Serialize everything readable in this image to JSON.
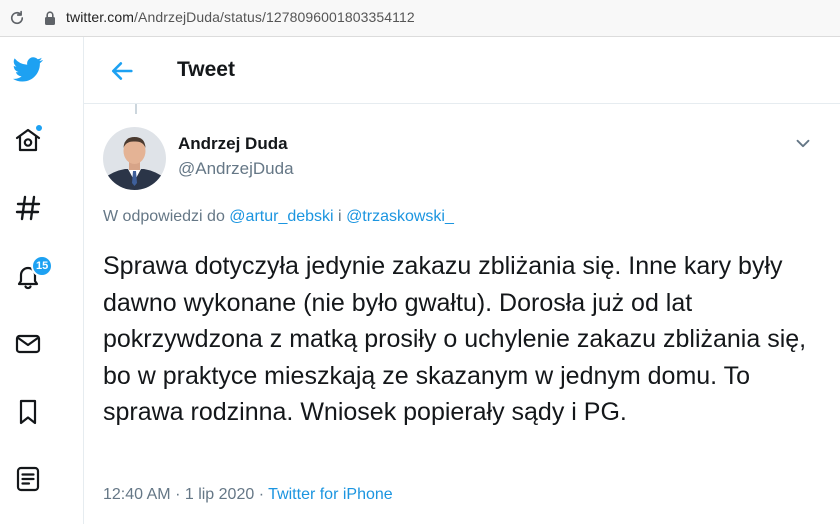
{
  "browser": {
    "url_host": "twitter.com",
    "url_path": "/AndrzejDuda/status/1278096001803354112"
  },
  "sidebar": {
    "items": [
      {
        "name": "twitter-logo"
      },
      {
        "name": "home-icon"
      },
      {
        "name": "explore-icon"
      },
      {
        "name": "notifications-icon",
        "badge": "15"
      },
      {
        "name": "messages-icon"
      },
      {
        "name": "bookmarks-icon"
      },
      {
        "name": "lists-icon"
      }
    ]
  },
  "header": {
    "title": "Tweet"
  },
  "tweet": {
    "author_name": "Andrzej Duda",
    "author_handle": "@AndrzejDuda",
    "reply_prefix": "W odpowiedzi do",
    "reply_mention_1": "@artur_debski",
    "reply_joiner": "i",
    "reply_mention_2": "@trzaskowski_",
    "text": "Sprawa dotyczyła jedynie zakazu zbliżania się. Inne kary były dawno wykonane (nie było gwałtu). Dorosła już od lat pokrzywdzona z matką prosiły o uchylenie zakazu zbliżania się, bo w praktyce mieszkają ze skazanym w jednym domu. To sprawa rodzinna. Wniosek popierały sądy i PG.",
    "time": "12:40 AM",
    "separator": "·",
    "date": "1 lip 2020",
    "source": "Twitter for iPhone"
  },
  "colors": {
    "accent": "#1da1f2",
    "link": "#1b95e0",
    "secondary_text": "#657786"
  }
}
